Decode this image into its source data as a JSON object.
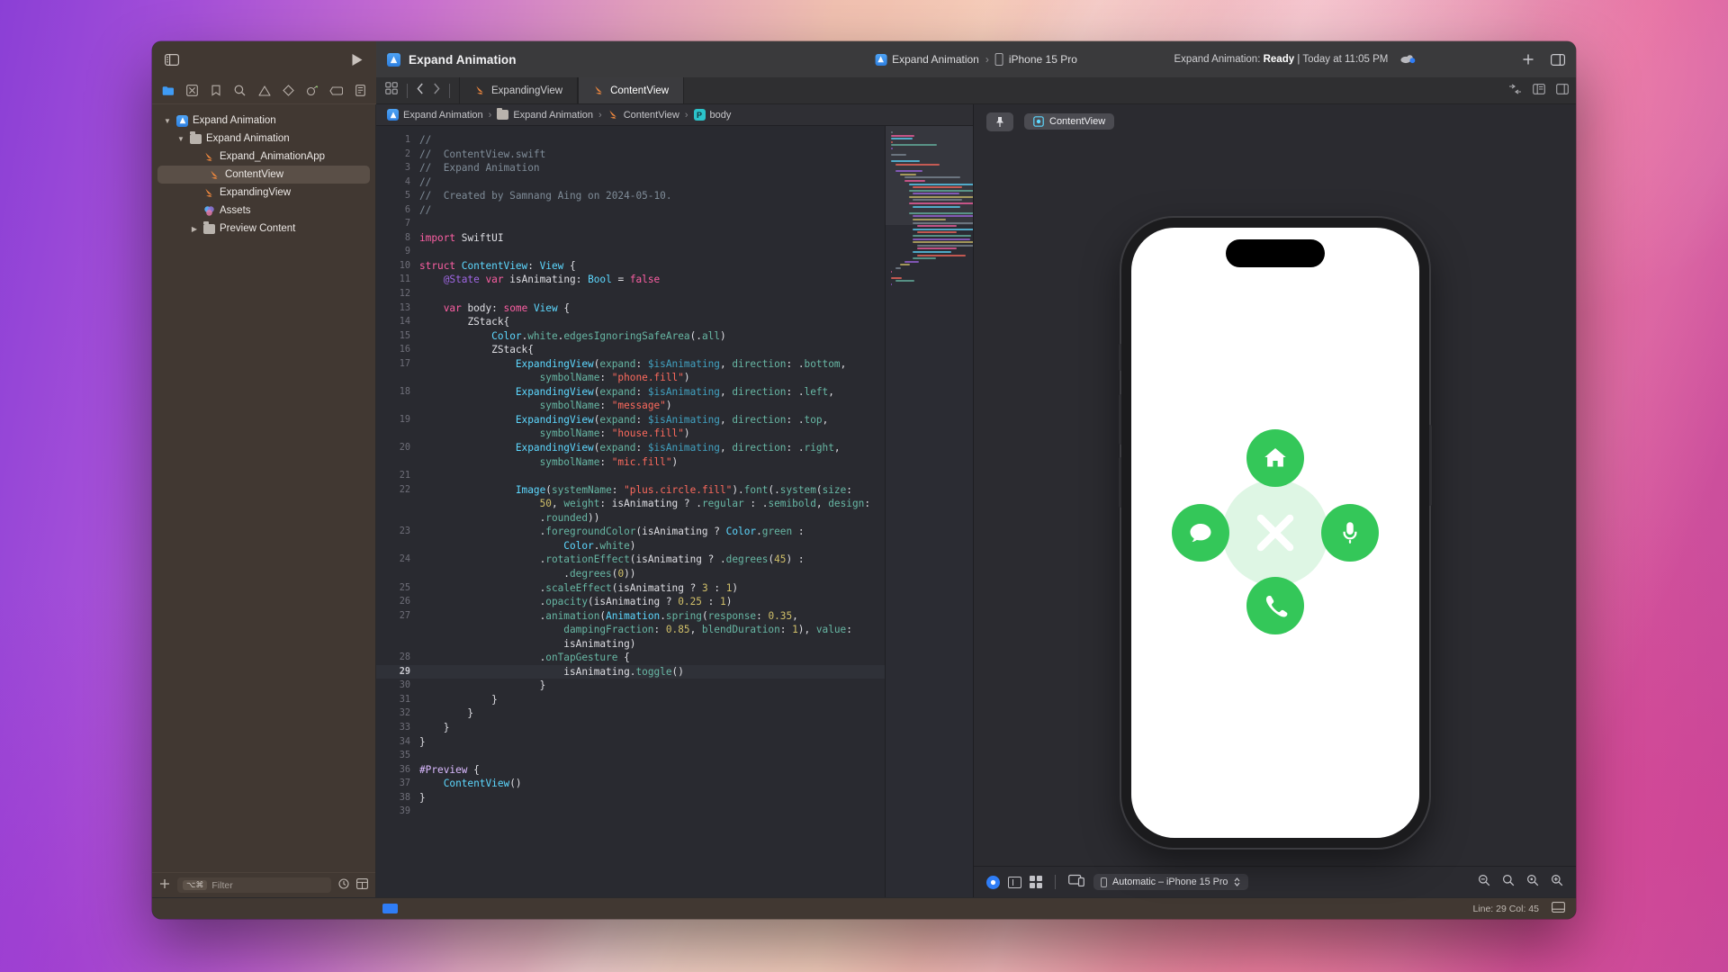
{
  "app": {
    "name": "Xcode",
    "project_title": "Expand Animation"
  },
  "toolbar": {
    "sidebar_toggle_icon": "sidebar-icon",
    "run_icon": "play-icon",
    "project_icon": "xcode-project-icon",
    "scheme": "Expand Animation",
    "scheme_separator": "›",
    "destination": "iPhone 15 Pro",
    "destination_icon": "iphone-icon",
    "status_prefix": "Expand Animation:",
    "status_state": "Ready",
    "status_divider": "|",
    "status_time": "Today at 11:05 PM",
    "cloud_icon": "cloud-icon",
    "add_icon": "plus-icon",
    "inspector_icon": "inspector-panel-icon"
  },
  "navigator": {
    "icons": [
      {
        "name": "folder-icon",
        "active": true
      },
      {
        "name": "source-control-icon",
        "active": false
      },
      {
        "name": "bookmarks-icon",
        "active": false
      },
      {
        "name": "find-icon",
        "active": false
      },
      {
        "name": "issues-icon",
        "active": false
      },
      {
        "name": "tests-icon",
        "active": false
      },
      {
        "name": "debug-icon",
        "active": false
      },
      {
        "name": "breakpoints-icon",
        "active": false
      },
      {
        "name": "reports-icon",
        "active": false
      }
    ],
    "tree": [
      {
        "label": "Expand Animation",
        "icon": "xcode-project-icon",
        "depth": 0,
        "chevron": "down",
        "selected": false
      },
      {
        "label": "Expand Animation",
        "icon": "folder-icon",
        "depth": 1,
        "chevron": "down",
        "selected": false
      },
      {
        "label": "Expand_AnimationApp",
        "icon": "swift-file-icon",
        "depth": 2,
        "chevron": "",
        "selected": false
      },
      {
        "label": "ContentView",
        "icon": "swift-file-icon",
        "depth": 2,
        "chevron": "",
        "selected": true
      },
      {
        "label": "ExpandingView",
        "icon": "swift-file-icon",
        "depth": 2,
        "chevron": "",
        "selected": false
      },
      {
        "label": "Assets",
        "icon": "assets-catalog-icon",
        "depth": 2,
        "chevron": "",
        "selected": false
      },
      {
        "label": "Preview Content",
        "icon": "folder-icon",
        "depth": 2,
        "chevron": "right",
        "selected": false
      }
    ],
    "filter_placeholder": "Filter",
    "filter_pill": "⌥⌘",
    "add_icon": "plus-icon",
    "history_icon": "clock-icon",
    "layout_icon": "layout-icon"
  },
  "tabs": {
    "grid_icon": "tab-grid-icon",
    "back_icon": "chevron-left-icon",
    "forward_icon": "chevron-right-icon",
    "items": [
      {
        "label": "ExpandingView",
        "active": false
      },
      {
        "label": "ContentView",
        "active": true
      }
    ],
    "right_icons": [
      "split-editor-icon",
      "code-review-icon",
      "adjust-editor-icon"
    ]
  },
  "breadcrumb": [
    {
      "label": "Expand Animation",
      "icon": "xcode-project-icon"
    },
    {
      "label": "Expand Animation",
      "icon": "folder-icon"
    },
    {
      "label": "ContentView",
      "icon": "swift-file-icon"
    },
    {
      "label": "body",
      "icon": "property-icon"
    }
  ],
  "editor": {
    "file": "ContentView.swift",
    "highlighted_line": 29,
    "lines": [
      {
        "n": 1,
        "html": "<span class='c'>//</span>"
      },
      {
        "n": 2,
        "html": "<span class='c'>//  ContentView.swift</span>"
      },
      {
        "n": 3,
        "html": "<span class='c'>//  Expand Animation</span>"
      },
      {
        "n": 4,
        "html": "<span class='c'>//</span>"
      },
      {
        "n": 5,
        "html": "<span class='c'>//  Created by Samnang Aing on 2024-05-10.</span>"
      },
      {
        "n": 6,
        "html": "<span class='c'>//</span>"
      },
      {
        "n": 7,
        "html": ""
      },
      {
        "n": 8,
        "html": "<span class='k'>import</span> <span class='id'>SwiftUI</span>"
      },
      {
        "n": 9,
        "html": ""
      },
      {
        "n": 10,
        "html": "<span class='k'>struct</span> <span class='t'>ContentView</span>: <span class='t'>View</span> {"
      },
      {
        "n": 11,
        "html": "    <span class='p'>@State</span> <span class='k'>var</span> <span class='id'>isAnimating</span>: <span class='t'>Bool</span> = <span class='k'>false</span>"
      },
      {
        "n": 12,
        "html": ""
      },
      {
        "n": 13,
        "html": "    <span class='k'>var</span> <span class='id'>body</span>: <span class='k'>some</span> <span class='t'>View</span> {"
      },
      {
        "n": 14,
        "html": "        <span class='id'>ZStack</span>{"
      },
      {
        "n": 15,
        "html": "            <span class='t'>Color</span>.<span class='f'>white</span>.<span class='f'>edgesIgnoringSafeArea</span>(.<span class='f'>all</span>)"
      },
      {
        "n": 16,
        "html": "            <span class='id'>ZStack</span>{"
      },
      {
        "n": 17,
        "html": "                <span class='t'>ExpandingView</span>(<span class='f'>expand</span>: <span class='v'>$isAnimating</span>, <span class='f'>direction</span>: .<span class='f'>bottom</span>,"
      },
      {
        "n": null,
        "html": "                    <span class='f'>symbolName</span>: <span class='s'>\"phone.fill\"</span>)"
      },
      {
        "n": 18,
        "html": "                <span class='t'>ExpandingView</span>(<span class='f'>expand</span>: <span class='v'>$isAnimating</span>, <span class='f'>direction</span>: .<span class='f'>left</span>,"
      },
      {
        "n": null,
        "html": "                    <span class='f'>symbolName</span>: <span class='s'>\"message\"</span>)"
      },
      {
        "n": 19,
        "html": "                <span class='t'>ExpandingView</span>(<span class='f'>expand</span>: <span class='v'>$isAnimating</span>, <span class='f'>direction</span>: .<span class='f'>top</span>,"
      },
      {
        "n": null,
        "html": "                    <span class='f'>symbolName</span>: <span class='s'>\"house.fill\"</span>)"
      },
      {
        "n": 20,
        "html": "                <span class='t'>ExpandingView</span>(<span class='f'>expand</span>: <span class='v'>$isAnimating</span>, <span class='f'>direction</span>: .<span class='f'>right</span>,"
      },
      {
        "n": null,
        "html": "                    <span class='f'>symbolName</span>: <span class='s'>\"mic.fill\"</span>)"
      },
      {
        "n": 21,
        "html": ""
      },
      {
        "n": 22,
        "html": "                <span class='t'>Image</span>(<span class='f'>systemName</span>: <span class='s'>\"plus.circle.fill\"</span>).<span class='f'>font</span>(.<span class='f'>system</span>(<span class='f'>size</span>:"
      },
      {
        "n": null,
        "html": "                    <span class='n'>50</span>, <span class='f'>weight</span>: <span class='id'>isAnimating</span> ? .<span class='f'>regular</span> : .<span class='f'>semibold</span>, <span class='f'>design</span>:"
      },
      {
        "n": null,
        "html": "                    .<span class='f'>rounded</span>))"
      },
      {
        "n": 23,
        "html": "                    .<span class='f'>foregroundColor</span>(<span class='id'>isAnimating</span> ? <span class='t'>Color</span>.<span class='f'>green</span> :"
      },
      {
        "n": null,
        "html": "                        <span class='t'>Color</span>.<span class='f'>white</span>)"
      },
      {
        "n": 24,
        "html": "                    .<span class='f'>rotationEffect</span>(<span class='id'>isAnimating</span> ? .<span class='f'>degrees</span>(<span class='n'>45</span>) :"
      },
      {
        "n": null,
        "html": "                        .<span class='f'>degrees</span>(<span class='n'>0</span>))"
      },
      {
        "n": 25,
        "html": "                    .<span class='f'>scaleEffect</span>(<span class='id'>isAnimating</span> ? <span class='n'>3</span> : <span class='n'>1</span>)"
      },
      {
        "n": 26,
        "html": "                    .<span class='f'>opacity</span>(<span class='id'>isAnimating</span> ? <span class='n'>0.25</span> : <span class='n'>1</span>)"
      },
      {
        "n": 27,
        "html": "                    .<span class='f'>animation</span>(<span class='t'>Animation</span>.<span class='f'>spring</span>(<span class='f'>response</span>: <span class='n'>0.35</span>,"
      },
      {
        "n": null,
        "html": "                        <span class='f'>dampingFraction</span>: <span class='n'>0.85</span>, <span class='f'>blendDuration</span>: <span class='n'>1</span>), <span class='f'>value</span>:"
      },
      {
        "n": null,
        "html": "                        <span class='id'>isAnimating</span>)"
      },
      {
        "n": 28,
        "html": "                    .<span class='f'>onTapGesture</span> {"
      },
      {
        "n": 29,
        "html": "                        <span class='id'>isAnimating</span>.<span class='f'>toggle</span>()",
        "hl": true
      },
      {
        "n": 30,
        "html": "                    }"
      },
      {
        "n": 31,
        "html": "            }"
      },
      {
        "n": 32,
        "html": "        }"
      },
      {
        "n": 33,
        "html": "    }"
      },
      {
        "n": 34,
        "html": "}"
      },
      {
        "n": 35,
        "html": ""
      },
      {
        "n": 36,
        "html": "<span class='pl'>#Preview</span> {"
      },
      {
        "n": 37,
        "html": "    <span class='t'>ContentView</span>()"
      },
      {
        "n": 38,
        "html": "}"
      },
      {
        "n": 39,
        "html": ""
      }
    ]
  },
  "canvas": {
    "pin_icon": "pin-icon",
    "preview_label": "ContentView",
    "preview_icon": "preview-icon",
    "device": "Automatic – iPhone 15 Pro",
    "device_icon": "iphone-icon",
    "live_icon": "live-preview-icon",
    "selectable_icon": "selectable-icon",
    "variants_icon": "variants-icon",
    "device_settings_icon": "device-settings-icon",
    "zoom_icons": [
      "zoom-out-icon",
      "zoom-to-fit-icon",
      "zoom-100-icon",
      "zoom-in-icon"
    ],
    "preview_content": {
      "background": "#ffffff",
      "accent_color": "#34c759",
      "center_glyph": "plus-rotated-45",
      "bubbles": [
        {
          "position": "top",
          "symbol": "house.fill",
          "icon": "house-icon"
        },
        {
          "position": "left",
          "symbol": "message",
          "icon": "message-icon"
        },
        {
          "position": "right",
          "symbol": "mic.fill",
          "icon": "mic-icon"
        },
        {
          "position": "bottom",
          "symbol": "phone.fill",
          "icon": "phone-icon"
        }
      ]
    }
  },
  "statusbar": {
    "filter_icon": "blue-indicator",
    "line_col": "Line: 29  Col: 45",
    "right_icon": "console-toggle-icon"
  }
}
